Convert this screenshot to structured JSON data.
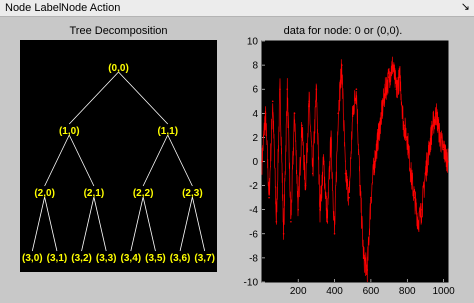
{
  "menu": {
    "items": [
      "Node Label",
      "Node Action"
    ],
    "dock_icon": "dock-arrow-icon"
  },
  "tree_panel": {
    "title": "Tree Decomposition",
    "nodes": [
      {
        "label": "(0,0)",
        "depth": 0,
        "pos": 0
      },
      {
        "label": "(1,0)",
        "depth": 1,
        "pos": 0
      },
      {
        "label": "(1,1)",
        "depth": 1,
        "pos": 1
      },
      {
        "label": "(2,0)",
        "depth": 2,
        "pos": 0
      },
      {
        "label": "(2,1)",
        "depth": 2,
        "pos": 1
      },
      {
        "label": "(2,2)",
        "depth": 2,
        "pos": 2
      },
      {
        "label": "(2,3)",
        "depth": 2,
        "pos": 3
      },
      {
        "label": "(3,0)",
        "depth": 3,
        "pos": 0
      },
      {
        "label": "(3,1)",
        "depth": 3,
        "pos": 1
      },
      {
        "label": "(3,2)",
        "depth": 3,
        "pos": 2
      },
      {
        "label": "(3,3)",
        "depth": 3,
        "pos": 3
      },
      {
        "label": "(3,4)",
        "depth": 3,
        "pos": 4
      },
      {
        "label": "(3,5)",
        "depth": 3,
        "pos": 5
      },
      {
        "label": "(3,6)",
        "depth": 3,
        "pos": 6
      },
      {
        "label": "(3,7)",
        "depth": 3,
        "pos": 7
      }
    ],
    "node_color": "#ffff00",
    "edge_color": "#ffffff"
  },
  "signal_panel": {
    "title": "data for node: 0 or (0,0)."
  },
  "chart_data": {
    "type": "line",
    "title": "data for node: 0 or (0,0).",
    "xlabel": "",
    "ylabel": "",
    "xlim": [
      1,
      1024
    ],
    "ylim": [
      -10,
      10
    ],
    "xticks": [
      200,
      400,
      600,
      800,
      1000
    ],
    "yticks": [
      10,
      8,
      6,
      4,
      2,
      0,
      -2,
      -4,
      -6,
      -8,
      -10
    ],
    "grid": false,
    "series": [
      {
        "color": "#ff0000",
        "x": [
          1,
          20,
          40,
          60,
          80,
          100,
          120,
          140,
          160,
          180,
          200,
          220,
          240,
          260,
          280,
          300,
          320,
          340,
          360,
          380,
          400,
          420,
          440,
          460,
          480,
          500,
          520,
          540,
          560,
          580,
          600,
          620,
          640,
          660,
          680,
          700,
          720,
          740,
          760,
          780,
          800,
          820,
          840,
          860,
          880,
          900,
          920,
          940,
          960,
          980,
          1000,
          1024
        ],
        "values": [
          0,
          4,
          -3,
          5,
          -5,
          6,
          -6,
          6,
          -5,
          4,
          -4,
          3,
          -2,
          5,
          -1,
          6,
          -4,
          0,
          -5,
          2,
          -6,
          4,
          8,
          -1,
          -3,
          4,
          6,
          -2,
          -8,
          -9,
          -3,
          0,
          2,
          4,
          6,
          7,
          8,
          6,
          7,
          3,
          2,
          -1,
          -3,
          -5,
          -4,
          -1,
          1,
          3,
          4,
          2,
          1,
          0
        ]
      }
    ]
  }
}
